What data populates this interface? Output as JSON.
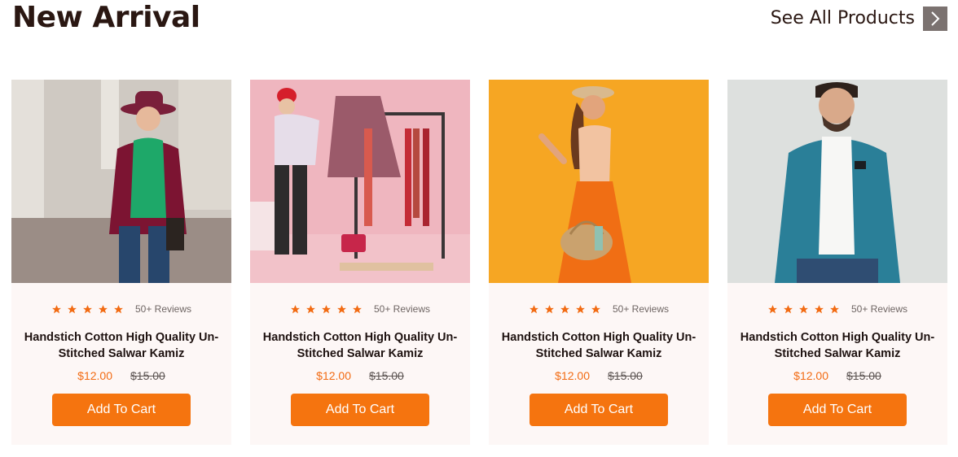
{
  "header": {
    "title": "New Arrival",
    "see_all_label": "See All Products",
    "see_all_icon": "chevron-right-icon"
  },
  "products": [
    {
      "image": "woman-burgundy-jacket-photo",
      "rating": 5,
      "reviews": "50+ Reviews",
      "title": "Handstich Cotton High Quality Un-Stitched Salwar Kamiz",
      "price": "$12.00",
      "old_price": "$15.00",
      "cta": "Add To Cart"
    },
    {
      "image": "woman-clothing-rack-photo",
      "rating": 5,
      "reviews": "50+ Reviews",
      "title": "Handstich Cotton High Quality Un-Stitched Salwar Kamiz",
      "price": "$12.00",
      "old_price": "$15.00",
      "cta": "Add To Cart"
    },
    {
      "image": "woman-orange-skirt-photo",
      "rating": 5,
      "reviews": "50+ Reviews",
      "title": "Handstich Cotton High Quality Un-Stitched Salwar Kamiz",
      "price": "$12.00",
      "old_price": "$15.00",
      "cta": "Add To Cart"
    },
    {
      "image": "man-denim-jacket-photo",
      "rating": 5,
      "reviews": "50+ Reviews",
      "title": "Handstich Cotton High Quality Un-Stitched Salwar Kamiz",
      "price": "$12.00",
      "old_price": "$15.00",
      "cta": "Add To Cart"
    }
  ],
  "colors": {
    "accent": "#f5740f",
    "star": "#f26b13",
    "card_bg": "#fdf7f6",
    "arrow_bg": "#7b7270"
  }
}
